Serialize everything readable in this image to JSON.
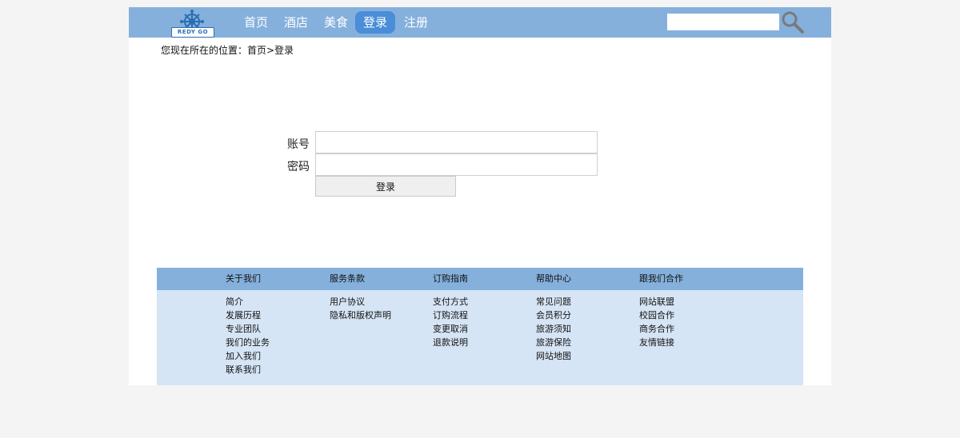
{
  "header": {
    "logo_text": "REDY GO",
    "nav": [
      {
        "label": "首页",
        "active": false
      },
      {
        "label": "酒店",
        "active": false
      },
      {
        "label": "美食",
        "active": false
      },
      {
        "label": "登录",
        "active": true
      },
      {
        "label": "注册",
        "active": false
      }
    ],
    "search": {
      "value": "",
      "placeholder": ""
    }
  },
  "breadcrumb": "您现在所在的位置：首页>登录",
  "login": {
    "account_label": "账号",
    "account_value": "",
    "password_label": "密码",
    "password_value": "",
    "submit_label": "登录"
  },
  "footer": {
    "columns": [
      {
        "title": "关于我们",
        "links": [
          "简介",
          "发展历程",
          "专业团队",
          "我们的业务",
          "加入我们",
          "联系我们"
        ]
      },
      {
        "title": "服务条款",
        "links": [
          "用户协议",
          "隐私和版权声明"
        ]
      },
      {
        "title": "订购指南",
        "links": [
          "支付方式",
          "订购流程",
          "变更取消",
          "退款说明"
        ]
      },
      {
        "title": "帮助中心",
        "links": [
          "常见问题",
          "会员积分",
          "旅游须知",
          "旅游保险",
          "网站地图"
        ]
      },
      {
        "title": "跟我们合作",
        "links": [
          "网站联盟",
          "校园合作",
          "商务合作",
          "友情链接"
        ]
      }
    ]
  },
  "colors": {
    "header_bg": "#85b0dc",
    "nav_active_bg": "#4a8dd8",
    "footer_bg": "#d6e5f5",
    "page_bg": "#f4f4f4"
  },
  "icons": {
    "logo": "ship-wheel-icon",
    "search": "search-icon"
  }
}
